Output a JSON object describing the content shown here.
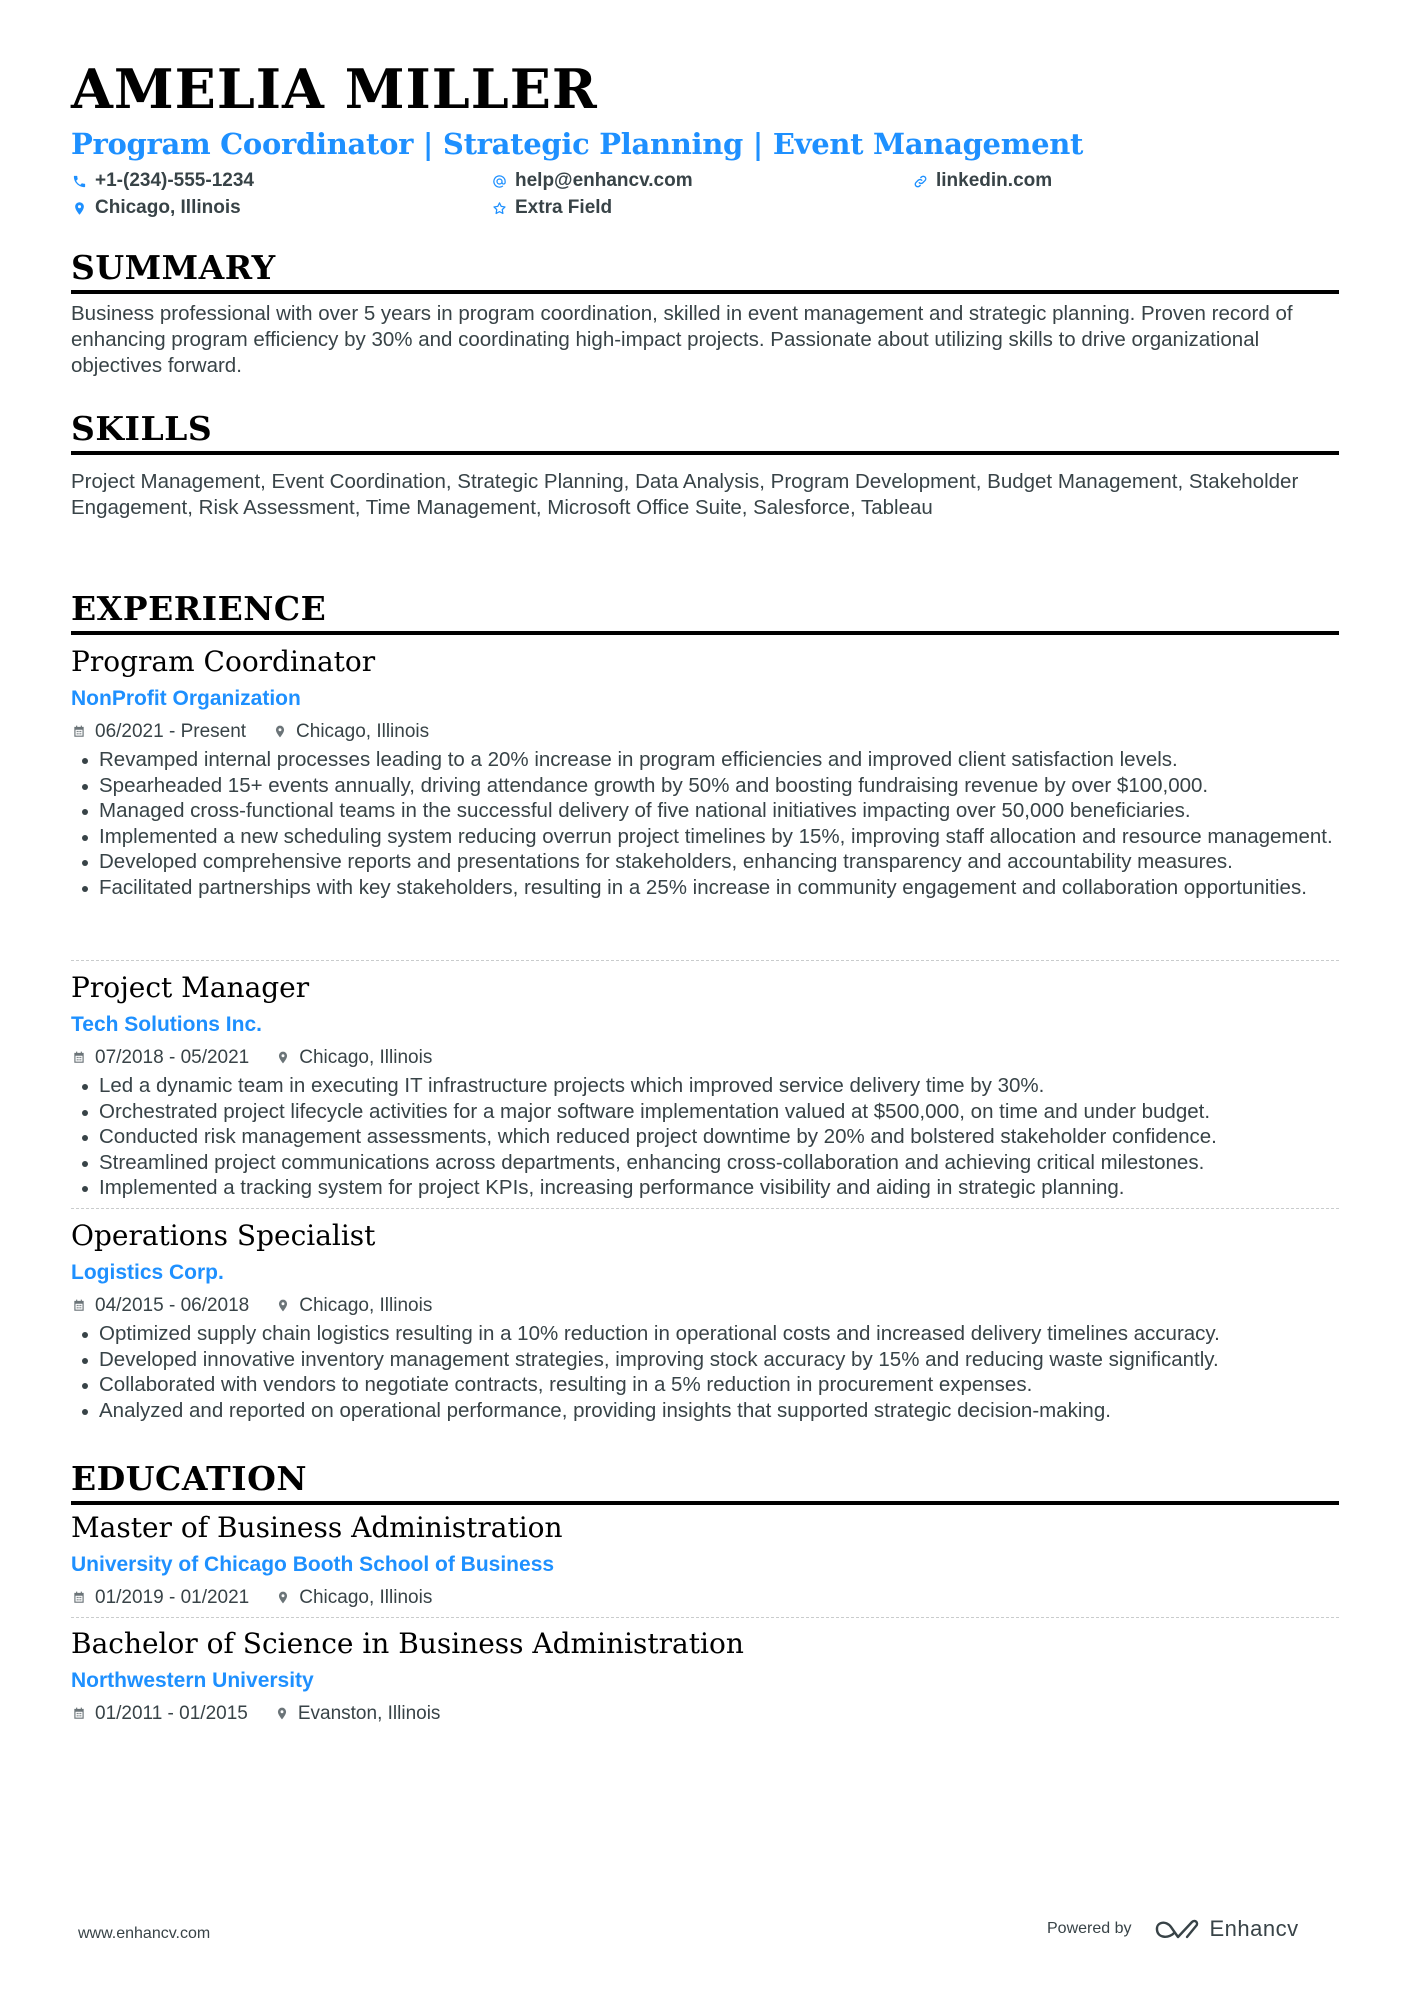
{
  "header": {
    "name": "AMELIA MILLER",
    "title": "Program Coordinator | Strategic Planning | Event Management",
    "contacts": {
      "phone": {
        "icon": "phone-icon",
        "value": "+1-(234)-555-1234"
      },
      "email": {
        "icon": "at-icon",
        "value": "help@enhancv.com"
      },
      "linkedin": {
        "icon": "link-icon",
        "value": "linkedin.com"
      },
      "location": {
        "icon": "map-pin-icon",
        "value": "Chicago, Illinois"
      },
      "extra": {
        "icon": "star-icon",
        "value": "Extra Field"
      }
    }
  },
  "summary": {
    "heading": "SUMMARY",
    "text": "Business professional with over 5 years in program coordination, skilled in event management and strategic planning. Proven record of enhancing program efficiency by 30% and coordinating high-impact projects. Passionate about utilizing skills to drive organizational objectives forward."
  },
  "skills": {
    "heading": "SKILLS",
    "text": "Project Management, Event Coordination, Strategic Planning, Data Analysis, Program Development, Budget Management, Stakeholder Engagement, Risk Assessment, Time Management, Microsoft Office Suite, Salesforce, Tableau"
  },
  "experience": {
    "heading": "EXPERIENCE",
    "jobs": [
      {
        "title": "Program Coordinator",
        "company": "NonProfit Organization",
        "dates": "06/2021 - Present",
        "location": "Chicago, Illinois",
        "bullets": [
          "Revamped internal processes leading to a 20% increase in program efficiencies and improved client satisfaction levels.",
          "Spearheaded 15+ events annually, driving attendance growth by 50% and boosting fundraising revenue by over $100,000.",
          "Managed cross-functional teams in the successful delivery of five national initiatives impacting over 50,000 beneficiaries.",
          "Implemented a new scheduling system reducing overrun project timelines by 15%, improving staff allocation and resource management.",
          "Developed comprehensive reports and presentations for stakeholders, enhancing transparency and accountability measures.",
          "Facilitated partnerships with key stakeholders, resulting in a 25% increase in community engagement and collaboration opportunities."
        ]
      },
      {
        "title": "Project Manager",
        "company": "Tech Solutions Inc.",
        "dates": "07/2018 - 05/2021",
        "location": "Chicago, Illinois",
        "bullets": [
          "Led a dynamic team in executing IT infrastructure projects which improved service delivery time by 30%.",
          "Orchestrated project lifecycle activities for a major software implementation valued at $500,000, on time and under budget.",
          "Conducted risk management assessments, which reduced project downtime by 20% and bolstered stakeholder confidence.",
          "Streamlined project communications across departments, enhancing cross-collaboration and achieving critical milestones.",
          "Implemented a tracking system for project KPIs, increasing performance visibility and aiding in strategic planning."
        ]
      },
      {
        "title": "Operations Specialist",
        "company": "Logistics Corp.",
        "dates": "04/2015 - 06/2018",
        "location": "Chicago, Illinois",
        "bullets": [
          "Optimized supply chain logistics resulting in a 10% reduction in operational costs and increased delivery timelines accuracy.",
          "Developed innovative inventory management strategies, improving stock accuracy by 15% and reducing waste significantly.",
          "Collaborated with vendors to negotiate contracts, resulting in a 5% reduction in procurement expenses.",
          "Analyzed and reported on operational performance, providing insights that supported strategic decision-making."
        ]
      }
    ]
  },
  "education": {
    "heading": "EDUCATION",
    "items": [
      {
        "degree": "Master of Business Administration",
        "school": "University of Chicago Booth School of Business",
        "dates": "01/2019 - 01/2021",
        "location": "Chicago, Illinois"
      },
      {
        "degree": "Bachelor of Science in Business Administration",
        "school": "Northwestern University",
        "dates": "01/2011 - 01/2015",
        "location": "Evanston, Illinois"
      }
    ]
  },
  "footer": {
    "website": "www.enhancv.com",
    "powered_by": "Powered by",
    "brand": "Enhancv"
  },
  "colors": {
    "accent": "#1e90ff",
    "text": "#384347",
    "heading": "#000000"
  }
}
